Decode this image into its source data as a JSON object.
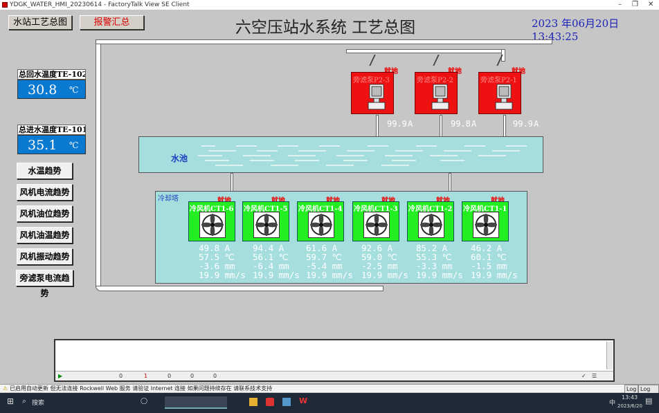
{
  "window": {
    "title": "YDGK_WATER_HMI_20230614 - FactoryTalk View SE Client",
    "min": "–",
    "max": "❐",
    "close": "✕"
  },
  "nav": {
    "overview": "水站工艺总图",
    "alarm": "报警汇总"
  },
  "main_title": "六空压站水系统 工艺总图",
  "datetime": "2023 年06月20日13:43:25",
  "temps": [
    {
      "label": "总回水温度TE-102",
      "value": "30.8",
      "unit": "℃"
    },
    {
      "label": "总进水温度TE-101",
      "value": "35.1",
      "unit": "℃"
    }
  ],
  "side_buttons": [
    "水温趋势",
    "风机电流趋势",
    "风机油位趋势",
    "风机油温趋势",
    "风机振动趋势",
    "旁滤泵电流趋势"
  ],
  "pumps": [
    {
      "label": "旁滤泵P2-3",
      "mode": "就地",
      "current": "99.9",
      "unit": "A"
    },
    {
      "label": "旁滤泵P2-2",
      "mode": "就地",
      "current": "99.8",
      "unit": "A"
    },
    {
      "label": "旁滤泵P2-1",
      "mode": "就地",
      "current": "99.9",
      "unit": "A"
    }
  ],
  "pool_label": "水池",
  "tower_label": "冷却塔",
  "fans": [
    {
      "label": "冷风机CT1-6",
      "mode": "就地",
      "current": "49.8",
      "temp": "57.5",
      "level": "-3.6",
      "vib": "19.9"
    },
    {
      "label": "冷风机CT1-5",
      "mode": "就地",
      "current": "94.4",
      "temp": "56.1",
      "level": "-6.4",
      "vib": "19.9"
    },
    {
      "label": "冷风机CT1-4",
      "mode": "就地",
      "current": "61.6",
      "temp": "59.7",
      "level": "-5.4",
      "vib": "19.9"
    },
    {
      "label": "冷风机CT1-3",
      "mode": "就地",
      "current": "92.6",
      "temp": "59.0",
      "level": "-2.5",
      "vib": "19.9"
    },
    {
      "label": "冷风机CT1-2",
      "mode": "就地",
      "current": "85.2",
      "temp": "55.3",
      "level": "-3.3",
      "vib": "19.9"
    },
    {
      "label": "冷风机CT1-1",
      "mode": "就地",
      "current": "46.2",
      "temp": "60.1",
      "level": "-1.5",
      "vib": "19.9"
    }
  ],
  "units": {
    "current": "A",
    "temp": "℃",
    "level": "mm",
    "vib": "mm/s"
  },
  "alarm_bar": {
    "c1": "0",
    "c2": "1",
    "c3": "0",
    "c4": "0",
    "c5": "0"
  },
  "status": {
    "message": "已启用自动更新 但无法连接 Rockwell Web 服务 请验证 Internet 连接 如果问题持续存在 请联系技术支持",
    "btn1": "Log",
    "btn2": "Log All"
  },
  "taskbar": {
    "search": "搜索",
    "time": "13:43",
    "date": "2023/6/20",
    "lang": "中"
  },
  "colors": {
    "pump": "#ee1111",
    "fan": "#22ee22",
    "pool": "#a6dede",
    "temp_box": "#0a7ad0",
    "datetime": "#1a22b8"
  }
}
